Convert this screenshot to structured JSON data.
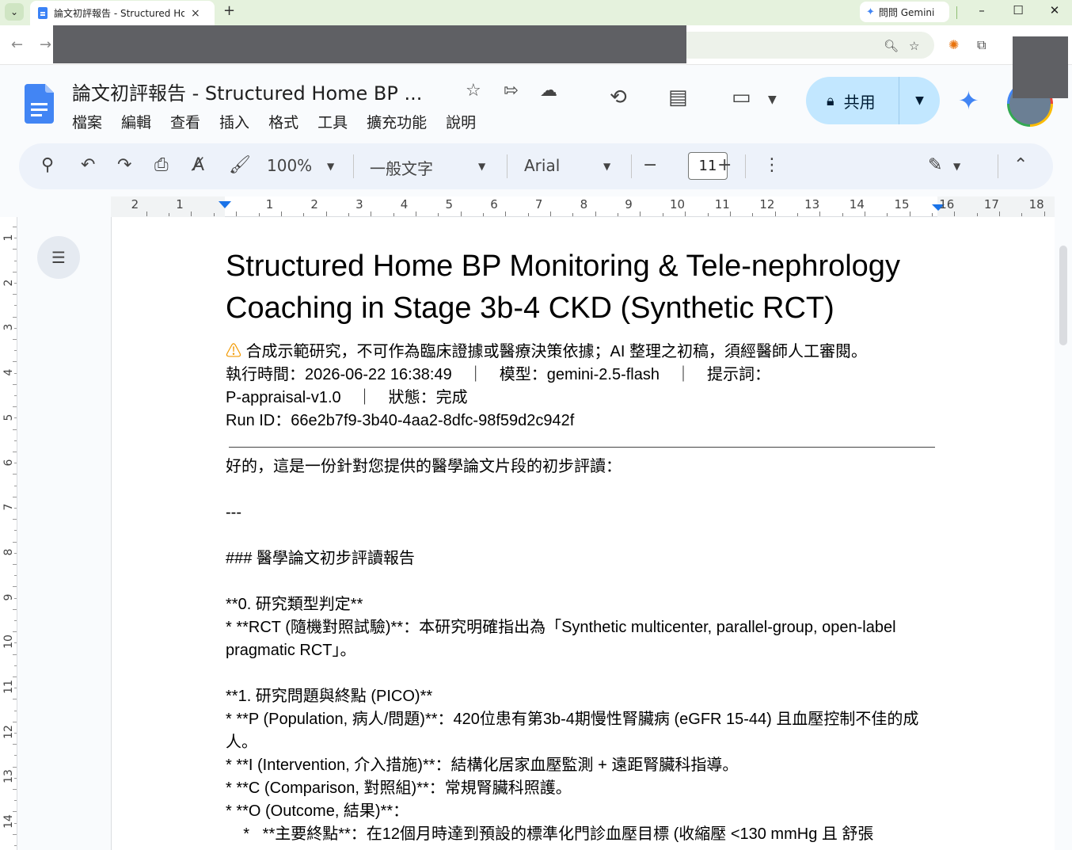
{
  "browser": {
    "tab_title": "論文初評報告 - Structured Home BP",
    "gemini_button": "問問 Gemini",
    "new_tab": "+",
    "tab_close": "×",
    "win_min": "–",
    "win_max": "☐",
    "win_close": "✕"
  },
  "docs": {
    "title": "論文初評報告 - Structured Home BP ...",
    "menu": [
      "檔案",
      "編輯",
      "查看",
      "插入",
      "格式",
      "工具",
      "擴充功能",
      "說明"
    ],
    "share_label": "共用"
  },
  "toolbar": {
    "zoom": "100%",
    "style": "一般文字",
    "font": "Arial",
    "font_size": "11"
  },
  "ruler": {
    "numbers": [
      "2",
      "1",
      "1",
      "2",
      "3",
      "4",
      "5",
      "6",
      "7",
      "8",
      "9",
      "10",
      "11",
      "12",
      "13",
      "14",
      "15",
      "16",
      "17",
      "18"
    ],
    "vertical_numbers": [
      "1",
      "2",
      "3",
      "4",
      "5",
      "6",
      "7",
      "8",
      "9",
      "10",
      "11",
      "12",
      "13",
      "14"
    ]
  },
  "document": {
    "heading_line1": "Structured Home BP Monitoring & Tele-nephrology",
    "heading_line2": "Coaching in Stage 3b-4 CKD (Synthetic RCT)",
    "warning_icon": "⚠",
    "warning_text": "合成示範研究，不可作為臨床證據或醫療決策依據；AI 整理之初稿，須經醫師人工審閱。",
    "meta_line1": "執行時間：2026-06-22 16:38:49　｜　模型：gemini-2.5-flash　｜　提示詞：",
    "meta_line2": "P-appraisal-v1.0　｜　狀態：完成",
    "meta_line3": "Run ID：66e2b7f9-3b40-4aa2-8dfc-98f59d2c942f",
    "intro": "好的，這是一份針對您提供的醫學論文片段的初步評讀：",
    "separator": "---",
    "section_heading": "### 醫學論文初步評讀報告",
    "s0_title": "**0. 研究類型判定**",
    "s0_item": "*   **RCT (隨機對照試驗)**：本研究明確指出為「Synthetic multicenter, parallel-group, open-label pragmatic RCT」。",
    "s1_title": "**1. 研究問題與終點 (PICO)**",
    "s1_p": "*   **P (Population, 病人/問題)**：420位患有第3b-4期慢性腎臟病 (eGFR 15-44) 且血壓控制不佳的成人。",
    "s1_i": "*   **I (Intervention, 介入措施)**：結構化居家血壓監測 + 遠距腎臟科指導。",
    "s1_c": "*   **C (Comparison, 對照組)**：常規腎臟科照護。",
    "s1_o": "*   **O (Outcome, 結果)**：",
    "s1_o_primary": "    *   **主要終點**：在12個月時達到預設的標準化門診血壓目標 (收縮壓 <130 mmHg 且 舒張"
  }
}
